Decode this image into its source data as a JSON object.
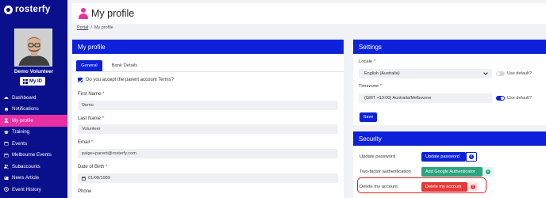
{
  "brand": {
    "name": "rosterfy"
  },
  "user": {
    "name": "Demo Volunteer",
    "myid_label": "My ID"
  },
  "nav": [
    {
      "label": "Dashboard",
      "icon": "gauge-icon"
    },
    {
      "label": "Notifications",
      "icon": "bell-icon"
    },
    {
      "label": "My profile",
      "icon": "user-icon",
      "active": true
    },
    {
      "label": "Training",
      "icon": "graduation-cap-icon"
    },
    {
      "label": "Events",
      "icon": "calendar-icon"
    },
    {
      "label": "Melbourne Events",
      "icon": "calendar-icon"
    },
    {
      "label": "Subaccounts",
      "icon": "users-icon"
    },
    {
      "label": "News Article",
      "icon": "newspaper-icon"
    },
    {
      "label": "Event History",
      "icon": "history-icon"
    }
  ],
  "header": {
    "title": "My profile"
  },
  "breadcrumb": {
    "portal": "Portal",
    "separator": "/",
    "current": "My profile"
  },
  "profile": {
    "title": "My profile",
    "tabs": [
      "General",
      "Bank Details"
    ],
    "terms_label": "Do you accept the parent account Terms?",
    "fields": {
      "first_name": {
        "label": "First Name",
        "value": "Demo"
      },
      "last_name": {
        "label": "Last Name",
        "value": "Volunteer"
      },
      "email": {
        "label": "Email",
        "value": "paige+parent@rosterfy.com"
      },
      "dob": {
        "label": "Date of Birth",
        "value": "01/08/1989"
      },
      "phone": {
        "label": "Phone"
      }
    },
    "required_mark": "*"
  },
  "settings": {
    "title": "Settings",
    "locale": {
      "label": "Locale",
      "value": "English (Australia)",
      "use_default_label": "Use default?",
      "use_default": false
    },
    "timezone": {
      "label": "Timezone",
      "value": "(GMT +10:00) Australia/Melbourne",
      "use_default_label": "Use default?",
      "use_default": true
    },
    "save_label": "Save"
  },
  "security": {
    "title": "Security",
    "update_password": {
      "label": "Update password",
      "button": "Update password"
    },
    "two_factor": {
      "label": "Two-factor authentication",
      "button": "Add Google Authenticator"
    },
    "delete_account": {
      "label": "Delete my account",
      "button": "Delete my account"
    }
  },
  "colors": {
    "sidebar": "#0a0f8c",
    "primary": "#0d22d8",
    "accent": "#e92fa4",
    "danger": "#e43a3a",
    "success": "#2aa37e"
  }
}
